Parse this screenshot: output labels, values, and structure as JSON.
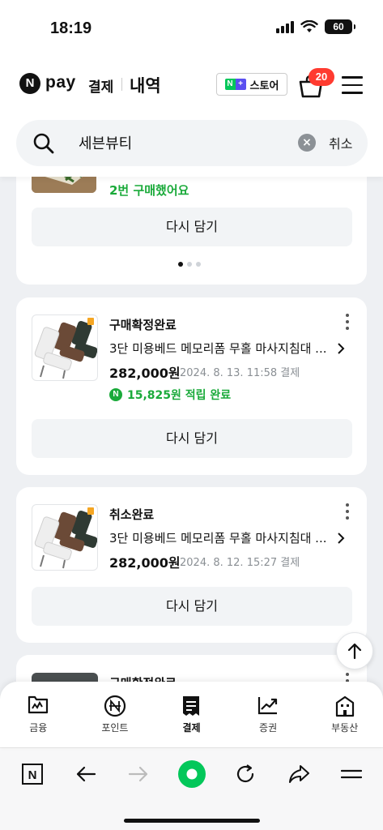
{
  "status_bar": {
    "time": "18:19",
    "battery": "60"
  },
  "header": {
    "brand_logo": "N",
    "brand": "pay",
    "brand_sub": "결제",
    "title": "내역",
    "store_badge_n": "N",
    "store_badge_plus": "+",
    "store_label": "스토어",
    "cart_count": "20"
  },
  "search": {
    "value": "세븐뷰티",
    "clear_icon": "×",
    "cancel": "취소"
  },
  "orders": [
    {
      "partial_text": "2번 구매했어요",
      "again": "다시 담기"
    },
    {
      "status": "구매확정완료",
      "name": "3단 미용베드 메모리폼 무홀 마사지침대 ...",
      "price": "282,000원",
      "date": "2024. 8. 13. 11:58 결제",
      "point_coin": "N",
      "points": "15,825원 적립 완료",
      "again": "다시 담기"
    },
    {
      "status": "취소완료",
      "name": "3단 미용베드 메모리폼 무홀 마사지침대 ...",
      "price": "282,000원",
      "date": "2024. 8. 12. 15:27 결제",
      "again": "다시 담기"
    },
    {
      "status": "구매확정완료"
    }
  ],
  "tabs": [
    {
      "label": "금융",
      "icon": "finance-icon"
    },
    {
      "label": "포인트",
      "icon": "point-icon"
    },
    {
      "label": "결제",
      "icon": "receipt-icon"
    },
    {
      "label": "증권",
      "icon": "stock-icon"
    },
    {
      "label": "부동산",
      "icon": "building-icon"
    }
  ],
  "browser": {
    "home_label": "N"
  },
  "colors": {
    "accent_green": "#1aaa3a",
    "badge_red": "#ff3b30",
    "naver_green": "#03c75a"
  }
}
